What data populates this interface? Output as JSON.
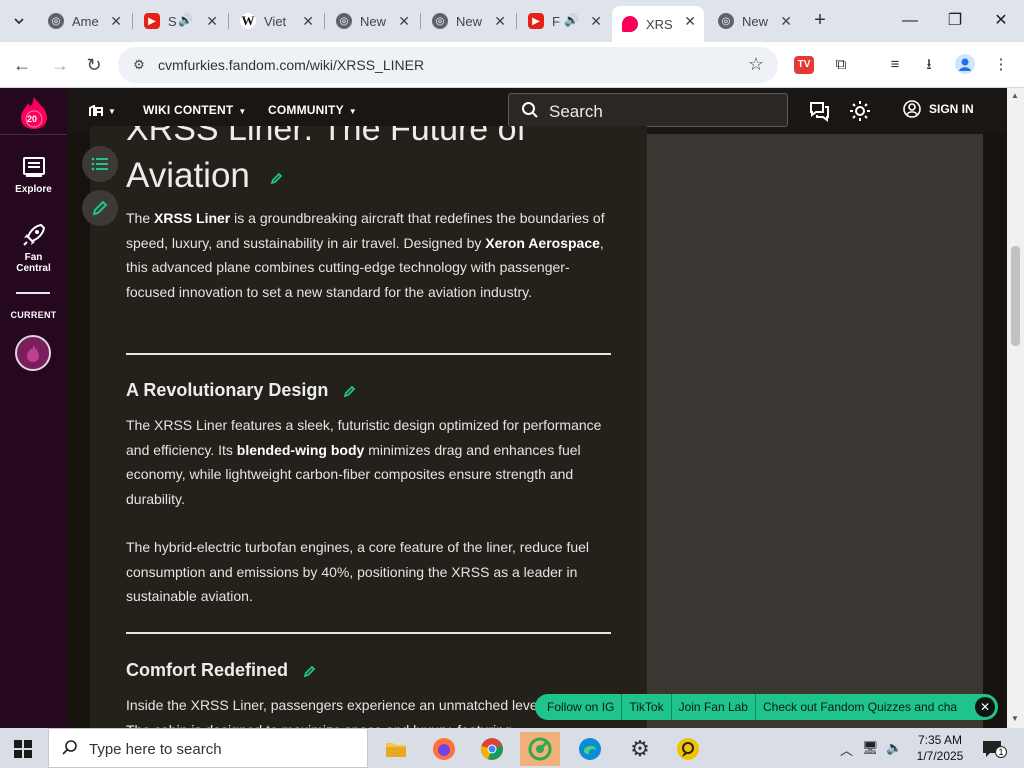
{
  "browser": {
    "tabs": [
      {
        "label": "Ame",
        "icon": "globe-icon"
      },
      {
        "label": "S",
        "icon": "youtube-icon"
      },
      {
        "label": "Viet",
        "icon": "wikipedia-icon"
      },
      {
        "label": "New",
        "icon": "globe-icon"
      },
      {
        "label": "New",
        "icon": "globe-icon"
      },
      {
        "label": "F",
        "icon": "youtube-icon"
      },
      {
        "label": "XRS",
        "icon": "fandom-icon",
        "active": true
      },
      {
        "label": "New",
        "icon": "globe-icon"
      }
    ],
    "url": "cvmfurkies.fandom.com/wiki/XRSS_LINER"
  },
  "globalnav": {
    "logo_badge": "20",
    "explore_label": "Explore",
    "fan_central_label": "Fan Central",
    "current_label": "CURRENT"
  },
  "wikinav": {
    "wiki_content_label": "WIKI CONTENT",
    "community_label": "COMMUNITY",
    "search_placeholder": "Search",
    "signin_label": "SIGN IN"
  },
  "article": {
    "title_line1": "XRSS Liner: The Future of",
    "title_line2": "Aviation",
    "intro": {
      "t1": "The ",
      "b1": "XRSS Liner",
      "t2": " is a groundbreaking aircraft that redefines the boundaries of speed, luxury, and sustainability in air travel. Designed by ",
      "b2": "Xeron Aerospace",
      "t3": ", this advanced plane combines cutting-edge technology with passenger-focused innovation to set a new standard for the aviation industry."
    },
    "h2_design": "A Revolutionary Design",
    "design_p1": {
      "t1": "The XRSS Liner features a sleek, futuristic design optimized for performance and efficiency. Its ",
      "b1": "blended-wing body",
      "t2": " minimizes drag and enhances fuel economy, while lightweight carbon-fiber composites ensure strength and durability."
    },
    "design_p2": "The hybrid-electric turbofan engines, a core feature of the liner, reduce fuel consumption and emissions by 40%, positioning the XRSS as a leader in sustainable aviation.",
    "h2_comfort": "Comfort Redefined",
    "comfort_p1": "Inside the XRSS Liner, passengers experience an unmatched level of comfort. The cabin is designed to maximize space and luxury, featuring"
  },
  "socialbar": {
    "items": [
      "Follow on IG",
      "TikTok",
      "Join Fan Lab",
      "Check out Fandom Quizzes and cha"
    ]
  },
  "taskbar": {
    "search_placeholder": "Type here to search",
    "time": "7:35 AM",
    "date": "1/7/2025",
    "notification_count": "1"
  },
  "colors": {
    "fandom_nav": "#25081f",
    "social_bar": "#1ec48b",
    "article_bg": "#24211b",
    "accent_green": "#1ec48b"
  }
}
